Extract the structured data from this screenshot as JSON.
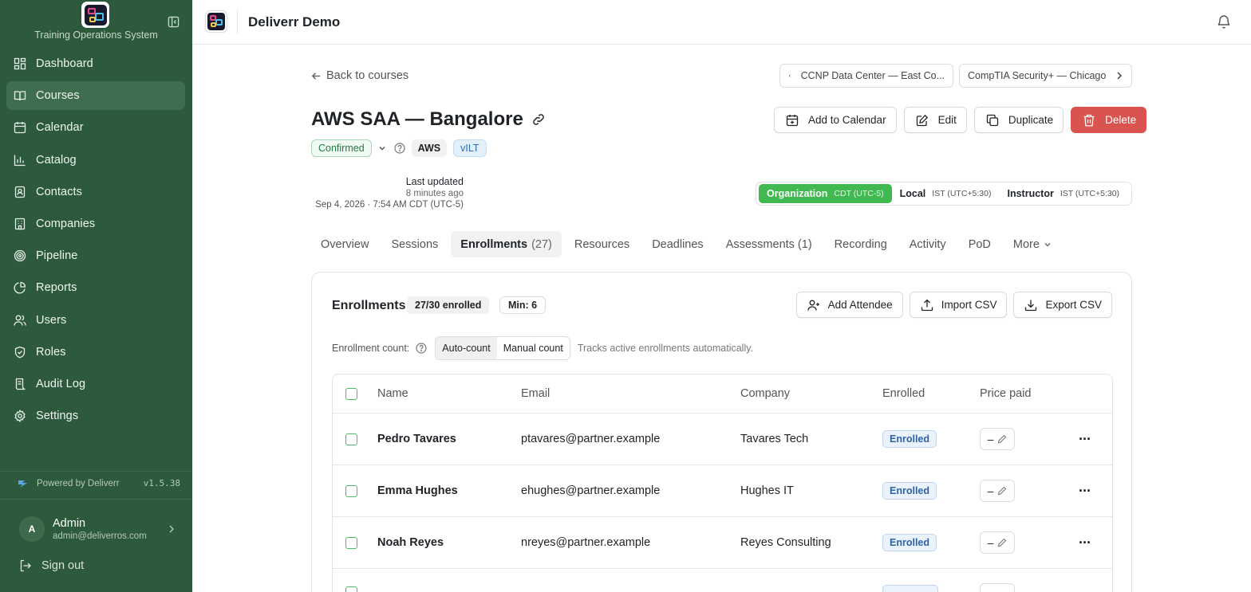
{
  "sidebar": {
    "system_name": "Training Operations System",
    "items": [
      {
        "label": "Dashboard",
        "icon": "dashboard-icon"
      },
      {
        "label": "Courses",
        "icon": "book-icon",
        "active": true
      },
      {
        "label": "Calendar",
        "icon": "calendar-icon"
      },
      {
        "label": "Catalog",
        "icon": "chart-icon"
      },
      {
        "label": "Contacts",
        "icon": "contact-book-icon"
      },
      {
        "label": "Companies",
        "icon": "building-icon"
      },
      {
        "label": "Pipeline",
        "icon": "target-icon"
      },
      {
        "label": "Reports",
        "icon": "pie-chart-icon"
      },
      {
        "label": "Users",
        "icon": "users-icon"
      },
      {
        "label": "Roles",
        "icon": "shield-icon"
      },
      {
        "label": "Audit Log",
        "icon": "log-icon"
      },
      {
        "label": "Settings",
        "icon": "gear-icon"
      }
    ],
    "powered_by": "Powered by Deliverr",
    "version": "v1.5.38",
    "user": {
      "initial": "A",
      "name": "Admin",
      "email": "admin@deliverros.com"
    },
    "sign_out": "Sign out"
  },
  "topbar": {
    "title": "Deliverr Demo"
  },
  "course": {
    "back_label": "Back to courses",
    "prev_course": "CCNP Data Center — East Co...",
    "next_course": "CompTIA Security+ — Chicago",
    "title": "AWS SAA — Bangalore",
    "status": "Confirmed",
    "tags": [
      "AWS",
      "vILT"
    ],
    "actions": {
      "add_calendar": "Add to Calendar",
      "edit": "Edit",
      "duplicate": "Duplicate",
      "delete": "Delete"
    },
    "last_updated": {
      "label": "Last updated",
      "relative": "8 minutes ago",
      "absolute": "Sep 4, 2026 · 7:54 AM CDT (UTC-5)"
    },
    "timezones": [
      {
        "name": "Organization",
        "tz": "CDT (UTC-5)",
        "active": true
      },
      {
        "name": "Local",
        "tz": "IST (UTC+5:30)"
      },
      {
        "name": "Instructor",
        "tz": "IST (UTC+5:30)"
      }
    ],
    "tabs": [
      {
        "label": "Overview"
      },
      {
        "label": "Sessions"
      },
      {
        "label": "Enrollments",
        "count": "(27)",
        "active": true
      },
      {
        "label": "Resources"
      },
      {
        "label": "Deadlines"
      },
      {
        "label": "Assessments (1)"
      },
      {
        "label": "Recording"
      },
      {
        "label": "Activity"
      },
      {
        "label": "PoD"
      },
      {
        "label": "More"
      }
    ]
  },
  "enrollments": {
    "title": "Enrollments",
    "enrolled_chip": "27/30 enrolled",
    "min_chip": "Min: 6",
    "add_attendee": "Add Attendee",
    "import_csv": "Import CSV",
    "export_csv": "Export CSV",
    "count_label": "Enrollment count:",
    "auto_count": "Auto-count",
    "manual_count": "Manual count",
    "hint": "Tracks active enrollments automatically.",
    "columns": [
      "Name",
      "Email",
      "Company",
      "Enrolled",
      "Price paid"
    ],
    "rows": [
      {
        "name": "Pedro Tavares",
        "email": "ptavares@partner.example",
        "company": "Tavares Tech",
        "status": "Enrolled",
        "price": "–"
      },
      {
        "name": "Emma Hughes",
        "email": "ehughes@partner.example",
        "company": "Hughes IT",
        "status": "Enrolled",
        "price": "–"
      },
      {
        "name": "Noah Reyes",
        "email": "nreyes@partner.example",
        "company": "Reyes Consulting",
        "status": "Enrolled",
        "price": "–"
      }
    ]
  },
  "colors": {
    "sidebar_bg": "#2d5a3d",
    "accent_green": "#3fb950",
    "delete_red": "#d9534f",
    "badge_blue": "#2c62a8"
  }
}
